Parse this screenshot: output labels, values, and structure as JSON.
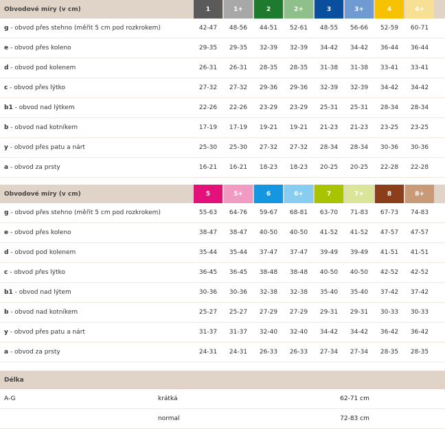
{
  "table1": {
    "title": "Obvodové míry (v cm)",
    "sizes": [
      {
        "label": "1",
        "color": "#5a5a5a"
      },
      {
        "label": "1+",
        "color": "#a8a8a8"
      },
      {
        "label": "2",
        "color": "#1e7a2e"
      },
      {
        "label": "2+",
        "color": "#8fbf8a"
      },
      {
        "label": "3",
        "color": "#0a4f9e"
      },
      {
        "label": "3+",
        "color": "#6f9ad2"
      },
      {
        "label": "4",
        "color": "#f6c200"
      },
      {
        "label": "4+",
        "color": "#f7df93"
      }
    ],
    "rows": [
      {
        "code": "g",
        "desc": " - obvod přes stehno (měřit 5 cm pod rozkrokem)",
        "values": [
          "42-47",
          "48-56",
          "44-51",
          "52-61",
          "48-55",
          "56-66",
          "52-59",
          "60-71"
        ]
      },
      {
        "code": "e",
        "desc": " - obvod přes koleno",
        "values": [
          "29-35",
          "29-35",
          "32-39",
          "32-39",
          "34-42",
          "34-42",
          "36-44",
          "36-44"
        ]
      },
      {
        "code": "d",
        "desc": " - obvod pod kolenem",
        "values": [
          "26-31",
          "26-31",
          "28-35",
          "28-35",
          "31-38",
          "31-38",
          "33-41",
          "33-41"
        ]
      },
      {
        "code": "c",
        "desc": " - obvod přes lýtko",
        "values": [
          "27-32",
          "27-32",
          "29-36",
          "29-36",
          "32-39",
          "32-39",
          "34-42",
          "34-42"
        ]
      },
      {
        "code": "b1",
        "desc": " - obvod nad lýtkem",
        "values": [
          "22-26",
          "22-26",
          "23-29",
          "23-29",
          "25-31",
          "25-31",
          "28-34",
          "28-34"
        ]
      },
      {
        "code": "b",
        "desc": " - obvod nad kotníkem",
        "values": [
          "17-19",
          "17-19",
          "19-21",
          "19-21",
          "21-23",
          "21-23",
          "23-25",
          "23-25"
        ]
      },
      {
        "code": "y",
        "desc": " - obvod přes patu a nárt",
        "values": [
          "25-30",
          "25-30",
          "27-32",
          "27-32",
          "28-34",
          "28-34",
          "30-36",
          "30-36"
        ]
      },
      {
        "code": "a",
        "desc": " - obvod za prsty",
        "values": [
          "16-21",
          "16-21",
          "18-23",
          "18-23",
          "20-25",
          "20-25",
          "22-28",
          "22-28"
        ]
      }
    ]
  },
  "table2": {
    "title": "Obvodové míry (v cm)",
    "sizes": [
      {
        "label": "5",
        "color": "#e2127a"
      },
      {
        "label": "5+",
        "color": "#f09ac4"
      },
      {
        "label": "6",
        "color": "#1497e0"
      },
      {
        "label": "6+",
        "color": "#86cdf1"
      },
      {
        "label": "7",
        "color": "#a8c400"
      },
      {
        "label": "7+",
        "color": "#dbe59a"
      },
      {
        "label": "8",
        "color": "#8a3e1a"
      },
      {
        "label": "8+",
        "color": "#c89a78"
      }
    ],
    "rows": [
      {
        "code": "g",
        "desc": " - obvod přes stehno (měřit 5 cm pod rozkrokem)",
        "values": [
          "55-63",
          "64-76",
          "59-67",
          "68-81",
          "63-70",
          "71-83",
          "67-73",
          "74-83"
        ]
      },
      {
        "code": "e",
        "desc": " - obvod přes koleno",
        "values": [
          "38-47",
          "38-47",
          "40-50",
          "40-50",
          "41-52",
          "41-52",
          "47-57",
          "47-57"
        ]
      },
      {
        "code": "d",
        "desc": " - obvod pod kolenem",
        "values": [
          "35-44",
          "35-44",
          "37-47",
          "37-47",
          "39-49",
          "39-49",
          "41-51",
          "41-51"
        ]
      },
      {
        "code": "c",
        "desc": " - obvod přes lýtko",
        "values": [
          "36-45",
          "36-45",
          "38-48",
          "38-48",
          "40-50",
          "40-50",
          "42-52",
          "42-52"
        ]
      },
      {
        "code": "b1",
        "desc": " - obvod nad lýtem",
        "values": [
          "30-36",
          "30-36",
          "32-38",
          "32-38",
          "35-40",
          "35-40",
          "37-42",
          "37-42"
        ]
      },
      {
        "code": "b",
        "desc": " - obvod nad kotníkem",
        "values": [
          "25-27",
          "25-27",
          "27-29",
          "27-29",
          "29-31",
          "29-31",
          "30-33",
          "30-33"
        ]
      },
      {
        "code": "y",
        "desc": " - obvod přes patu a nárt",
        "values": [
          "31-37",
          "31-37",
          "32-40",
          "32-40",
          "34-42",
          "34-42",
          "36-42",
          "36-42"
        ]
      },
      {
        "code": "a",
        "desc": " - obvod za prsty",
        "values": [
          "24-31",
          "24-31",
          "26-33",
          "26-33",
          "27-34",
          "27-34",
          "28-35",
          "28-35"
        ]
      }
    ]
  },
  "length": {
    "title": "Délka",
    "rows": [
      {
        "range": "A-G",
        "type": "krátká",
        "value": "62-71 cm"
      },
      {
        "range": "",
        "type": "normal",
        "value": "72-83 cm"
      }
    ]
  }
}
